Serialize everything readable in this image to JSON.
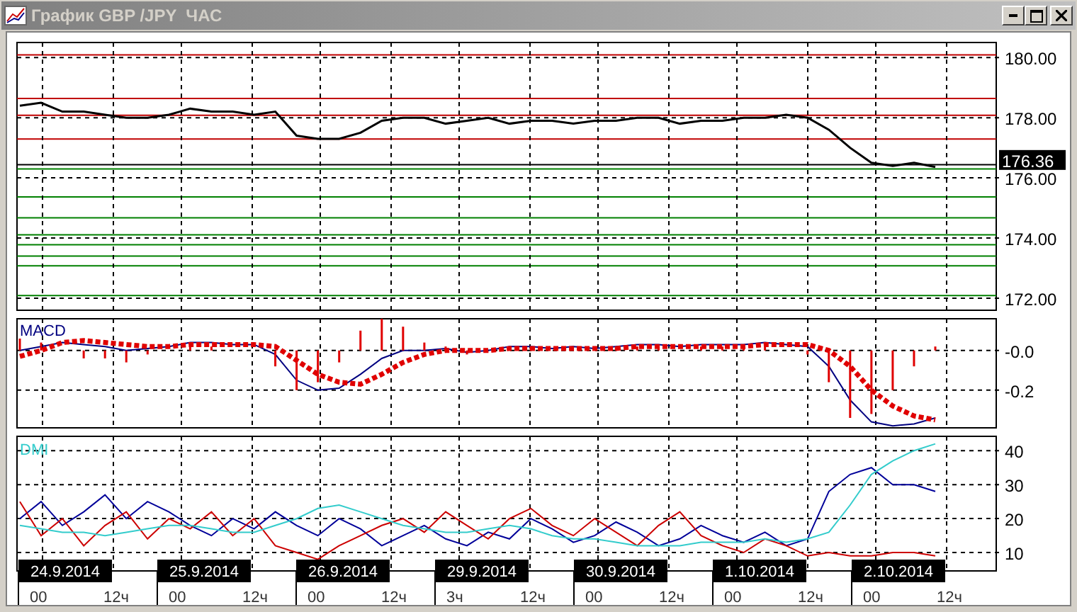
{
  "window": {
    "title": "График GBP /JPY  ЧАС"
  },
  "price": {
    "current": "176.36",
    "chart_data": {
      "type": "line",
      "grid": true,
      "ylim": [
        171.6,
        180.5
      ],
      "series": [
        {
          "color": "#000000",
          "values": [
            178.4,
            178.5,
            178.2,
            178.2,
            178.1,
            178.0,
            178.0,
            178.1,
            178.3,
            178.2,
            178.2,
            178.1,
            178.2,
            177.4,
            177.3,
            177.3,
            177.5,
            177.9,
            178.0,
            178.0,
            177.8,
            177.9,
            178.0,
            177.8,
            177.9,
            177.9,
            177.8,
            177.9,
            177.9,
            178.0,
            178.0,
            177.8,
            177.9,
            177.9,
            178.0,
            178.0,
            178.1,
            178.0,
            177.6,
            177.0,
            176.5,
            176.4,
            176.5,
            176.36
          ]
        }
      ],
      "yticks": [
        {
          "value": 180,
          "label": "180.00"
        },
        {
          "value": 178,
          "label": "178.00"
        },
        {
          "value": 176,
          "label": "176.00"
        },
        {
          "value": 174,
          "label": "174.00"
        },
        {
          "value": 172,
          "label": "172.00"
        }
      ],
      "ref_lines": [
        {
          "axis": "y",
          "value": 180.09,
          "color": "#c00000"
        },
        {
          "axis": "y",
          "value": 178.64,
          "color": "#c00000"
        },
        {
          "axis": "y",
          "value": 178.08,
          "color": "#c00000"
        },
        {
          "axis": "y",
          "value": 177.29,
          "color": "#c00000"
        },
        {
          "axis": "y",
          "value": 176.44,
          "color": "#000000"
        },
        {
          "axis": "y",
          "value": 176.3,
          "color": "#008000"
        },
        {
          "axis": "y",
          "value": 175.37,
          "color": "#008000"
        },
        {
          "axis": "y",
          "value": 174.67,
          "color": "#008000"
        },
        {
          "axis": "y",
          "value": 174.11,
          "color": "#008000"
        },
        {
          "axis": "y",
          "value": 173.78,
          "color": "#008000"
        },
        {
          "axis": "y",
          "value": 173.4,
          "color": "#008000"
        },
        {
          "axis": "y",
          "value": 173.08,
          "color": "#008000"
        },
        {
          "axis": "y",
          "value": 172.09,
          "color": "#008000"
        }
      ]
    }
  },
  "macd": {
    "label": "MACD",
    "chart_data": {
      "type": "line",
      "grid": true,
      "ylim": [
        -0.39,
        0.16
      ],
      "series": [
        {
          "color": "#000080",
          "line_style": "solid",
          "values": [
            0.0,
            0.02,
            0.04,
            0.03,
            0.02,
            0.0,
            0.01,
            0.02,
            0.04,
            0.04,
            0.03,
            0.03,
            -0.02,
            -0.15,
            -0.2,
            -0.19,
            -0.12,
            -0.04,
            0.0,
            0.0,
            0.01,
            -0.01,
            0.0,
            0.02,
            0.02,
            0.01,
            0.02,
            0.01,
            0.02,
            0.03,
            0.03,
            0.02,
            0.03,
            0.03,
            0.03,
            0.04,
            0.03,
            0.02,
            -0.08,
            -0.25,
            -0.36,
            -0.38,
            -0.37,
            -0.34
          ]
        },
        {
          "color": "#e00000",
          "line_style": "dotted",
          "values": [
            -0.03,
            0.0,
            0.04,
            0.05,
            0.04,
            0.03,
            0.02,
            0.02,
            0.03,
            0.03,
            0.03,
            0.03,
            0.02,
            -0.05,
            -0.12,
            -0.16,
            -0.17,
            -0.12,
            -0.06,
            -0.02,
            0.0,
            0.0,
            0.0,
            0.01,
            0.01,
            0.01,
            0.01,
            0.01,
            0.01,
            0.02,
            0.02,
            0.02,
            0.02,
            0.02,
            0.02,
            0.03,
            0.03,
            0.03,
            0.0,
            -0.08,
            -0.2,
            -0.28,
            -0.33,
            -0.35
          ]
        },
        {
          "type": "bar",
          "color": "#e00000",
          "values": [
            0.06,
            0.04,
            0,
            -0.04,
            -0.04,
            -0.06,
            -0.02,
            0,
            0.02,
            0.02,
            0,
            0,
            -0.08,
            -0.2,
            -0.16,
            -0.06,
            0.1,
            0.16,
            0.12,
            0.04,
            0.02,
            -0.02,
            0,
            0,
            0.02,
            0,
            0,
            0,
            0.02,
            0.02,
            0.02,
            0,
            0.02,
            0.02,
            0.02,
            0.02,
            0,
            -0.02,
            -0.16,
            -0.34,
            -0.32,
            -0.2,
            -0.08,
            0.02
          ]
        }
      ],
      "yticks": [
        {
          "value": 0,
          "label": "-0.0"
        },
        {
          "value": -0.2,
          "label": "-0.2"
        }
      ]
    }
  },
  "dmi": {
    "label": "DMI",
    "chart_data": {
      "type": "line",
      "grid": true,
      "ylim": [
        4.6,
        44.2
      ],
      "series": [
        {
          "color": "#000099",
          "values": [
            20,
            25,
            18,
            22,
            27,
            20,
            25,
            22,
            18,
            15,
            20,
            17,
            22,
            18,
            15,
            20,
            17,
            12,
            15,
            18,
            14,
            12,
            16,
            14,
            20,
            17,
            13,
            15,
            19,
            16,
            12,
            14,
            18,
            15,
            13,
            16,
            12,
            14,
            28,
            33,
            35,
            30,
            30,
            28
          ]
        },
        {
          "color": "#cc0000",
          "values": [
            25,
            15,
            20,
            12,
            18,
            22,
            14,
            20,
            17,
            22,
            15,
            20,
            12,
            10,
            8,
            12,
            15,
            18,
            20,
            16,
            22,
            18,
            14,
            20,
            23,
            18,
            15,
            20,
            16,
            12,
            18,
            22,
            15,
            12,
            10,
            14,
            12,
            9,
            10,
            9,
            9,
            10,
            10,
            9
          ]
        },
        {
          "color": "#33cccc",
          "values": [
            18,
            17,
            16,
            16,
            15,
            16,
            17,
            18,
            18,
            17,
            16,
            16,
            18,
            20,
            23,
            24,
            22,
            20,
            18,
            17,
            16,
            16,
            17,
            18,
            17,
            15,
            14,
            14,
            13,
            12,
            12,
            12,
            13,
            13,
            13,
            14,
            13,
            14,
            16,
            24,
            33,
            37,
            40,
            42
          ]
        }
      ],
      "yticks": [
        {
          "value": 40,
          "label": "40"
        },
        {
          "value": 30,
          "label": "30"
        },
        {
          "value": 20,
          "label": "20"
        },
        {
          "value": 10,
          "label": "10"
        }
      ]
    }
  },
  "time_axis": [
    {
      "date": "24.9.2014",
      "marks": [
        "00",
        "12ч"
      ]
    },
    {
      "date": "25.9.2014",
      "marks": [
        "00",
        "12ч"
      ]
    },
    {
      "date": "26.9.2014",
      "marks": [
        "00",
        "12ч"
      ]
    },
    {
      "date": "29.9.2014",
      "marks": [
        "3ч",
        "12ч"
      ]
    },
    {
      "date": "30.9.2014",
      "marks": [
        "00",
        "12ч"
      ]
    },
    {
      "date": "1.10.2014",
      "marks": [
        "00",
        "12ч"
      ]
    },
    {
      "date": "2.10.2014",
      "marks": [
        "00",
        "12ч"
      ]
    }
  ]
}
